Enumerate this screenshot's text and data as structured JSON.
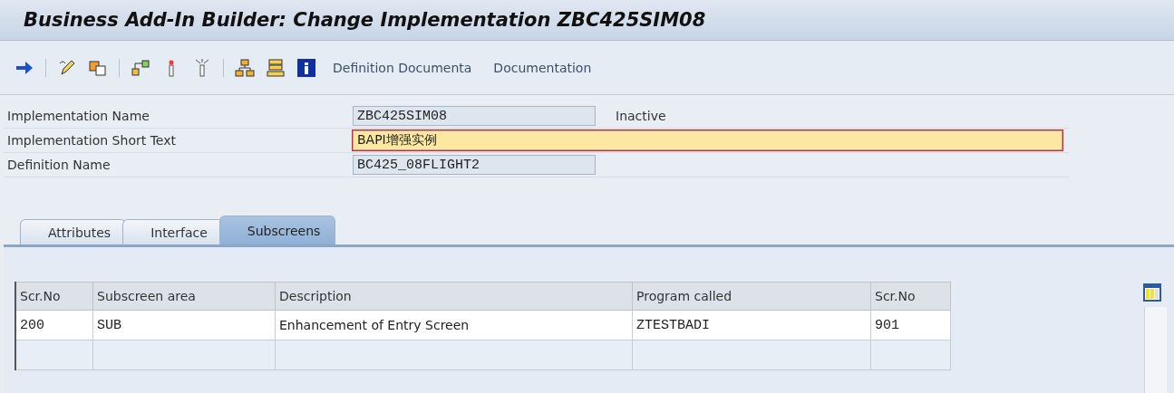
{
  "window": {
    "title": "Business Add-In Builder: Change Implementation ZBC425SIM08"
  },
  "toolbar": {
    "buttons": [
      "Definition Documenta",
      "Documentation"
    ]
  },
  "form": [
    {
      "label": "Implementation Name",
      "value": "ZBC425SIM08",
      "status": "Inactive",
      "kind": "display"
    },
    {
      "label": "Implementation Short Text",
      "value": "BAPI增强实例",
      "kind": "input"
    },
    {
      "label": "Definition Name",
      "value": "BC425_08FLIGHT2",
      "kind": "display"
    }
  ],
  "tabs": [
    {
      "label": "Attributes",
      "selected": false
    },
    {
      "label": "Interface",
      "selected": false
    },
    {
      "label": "Subscreens",
      "selected": true
    }
  ],
  "table": {
    "columns": [
      "Scr.No",
      "Subscreen area",
      "Description",
      "Program called",
      "Scr.No"
    ],
    "rows": [
      [
        "200",
        "SUB",
        "Enhancement of Entry Screen",
        "ZTESTBADI",
        "901"
      ]
    ]
  }
}
